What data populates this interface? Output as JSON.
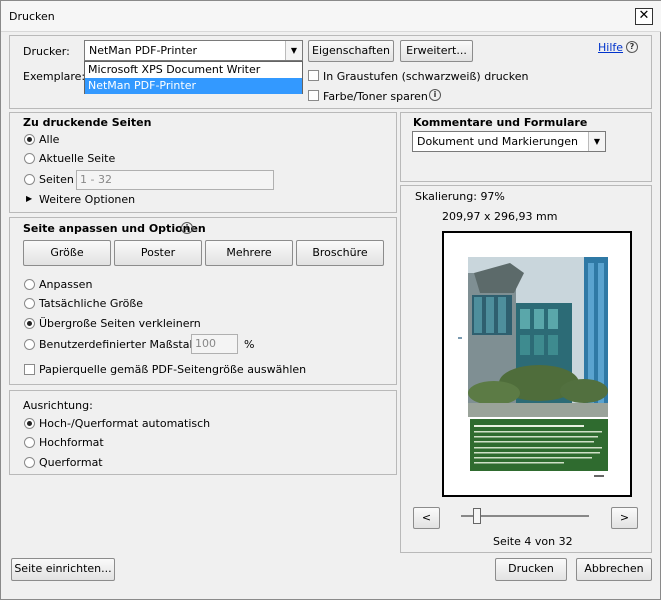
{
  "window": {
    "title": "Drucken"
  },
  "header": {
    "printer_label": "Drucker:",
    "printer_value": "NetMan PDF-Printer",
    "properties_button": "Eigenschaften",
    "advanced_button": "Erweitert...",
    "help_link": "Hilfe",
    "copies_label": "Exemplare:",
    "printer_options": [
      "Microsoft XPS Document Writer",
      "NetMan PDF-Printer"
    ],
    "grayscale_label": "In Graustufen (schwarzweiß) drucken",
    "save_toner_label": "Farbe/Toner sparen"
  },
  "pages": {
    "heading": "Zu druckende Seiten",
    "all": "Alle",
    "current": "Aktuelle Seite",
    "pages_label": "Seiten",
    "pages_value": "1 - 32",
    "more_options": "Weitere Optionen"
  },
  "fit": {
    "heading": "Seite anpassen und Optionen",
    "tabs": [
      "Größe",
      "Poster",
      "Mehrere",
      "Broschüre"
    ],
    "fit_label": "Anpassen",
    "actual_label": "Tatsächliche Größe",
    "shrink_label": "Übergroße Seiten verkleinern",
    "custom_label": "Benutzerdefinierter Maßstab:",
    "custom_value": "100",
    "percent": "%",
    "paper_source_label": "Papierquelle gemäß PDF-Seitengröße auswählen"
  },
  "orientation": {
    "heading": "Ausrichtung:",
    "auto": "Hoch-/Querformat automatisch",
    "portrait": "Hochformat",
    "landscape": "Querformat"
  },
  "comments": {
    "heading": "Kommentare und Formulare",
    "value": "Dokument und Markierungen"
  },
  "preview": {
    "scale_label": "Skalierung:",
    "scale_value": "97%",
    "dimensions": "209,97 x 296,93 mm",
    "prev": "<",
    "next": ">",
    "page_info": "Seite 4 von 32"
  },
  "footer": {
    "page_setup": "Seite einrichten...",
    "print": "Drucken",
    "cancel": "Abbrechen"
  }
}
